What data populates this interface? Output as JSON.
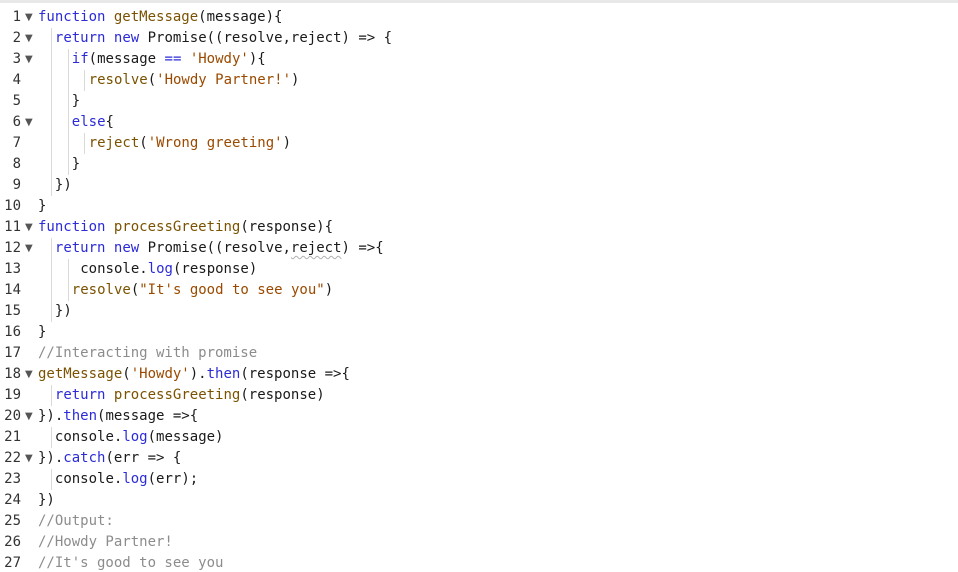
{
  "editor": {
    "lines": [
      {
        "n": "1",
        "fold": true,
        "indent": 0,
        "tokens": [
          [
            "kw",
            "function"
          ],
          [
            "pl",
            " "
          ],
          [
            "fn",
            "getMessage"
          ],
          [
            "pl",
            "(message){"
          ]
        ]
      },
      {
        "n": "2",
        "fold": true,
        "indent": 1,
        "tokens": [
          [
            "kw",
            "return"
          ],
          [
            "pl",
            " "
          ],
          [
            "kw",
            "new"
          ],
          [
            "pl",
            " Promise((resolve,reject) => {"
          ]
        ]
      },
      {
        "n": "3",
        "fold": true,
        "indent": 2,
        "tokens": [
          [
            "kw",
            "if"
          ],
          [
            "pl",
            "(message "
          ],
          [
            "kw",
            "=="
          ],
          [
            "pl",
            " "
          ],
          [
            "str",
            "'Howdy'"
          ],
          [
            "pl",
            "){"
          ]
        ]
      },
      {
        "n": "4",
        "fold": false,
        "indent": 3,
        "tokens": [
          [
            "fn",
            "resolve"
          ],
          [
            "pl",
            "("
          ],
          [
            "str",
            "'Howdy Partner!'"
          ],
          [
            "pl",
            ")"
          ]
        ]
      },
      {
        "n": "5",
        "fold": false,
        "indent": 2,
        "tokens": [
          [
            "pl",
            "}"
          ]
        ]
      },
      {
        "n": "6",
        "fold": true,
        "indent": 2,
        "tokens": [
          [
            "kw",
            "else"
          ],
          [
            "pl",
            "{"
          ]
        ]
      },
      {
        "n": "7",
        "fold": false,
        "indent": 3,
        "tokens": [
          [
            "fn",
            "reject"
          ],
          [
            "pl",
            "("
          ],
          [
            "str",
            "'Wrong greeting'"
          ],
          [
            "pl",
            ")"
          ]
        ]
      },
      {
        "n": "8",
        "fold": false,
        "indent": 2,
        "tokens": [
          [
            "pl",
            "}"
          ]
        ]
      },
      {
        "n": "9",
        "fold": false,
        "indent": 1,
        "tokens": [
          [
            "pl",
            "})"
          ]
        ]
      },
      {
        "n": "10",
        "fold": false,
        "indent": 0,
        "tokens": [
          [
            "pl",
            "}"
          ]
        ]
      },
      {
        "n": "11",
        "fold": true,
        "indent": 0,
        "tokens": [
          [
            "kw",
            "function"
          ],
          [
            "pl",
            " "
          ],
          [
            "fn",
            "processGreeting"
          ],
          [
            "pl",
            "(response){"
          ]
        ]
      },
      {
        "n": "12",
        "fold": true,
        "indent": 1,
        "tokens": [
          [
            "kw",
            "return"
          ],
          [
            "pl",
            " "
          ],
          [
            "kw",
            "new"
          ],
          [
            "pl",
            " Promise((resolve,"
          ],
          [
            "sq",
            "reject"
          ],
          [
            "pl",
            ") =>{"
          ]
        ]
      },
      {
        "n": "13",
        "fold": false,
        "indent": 2.5,
        "tokens": [
          [
            "pl",
            "console."
          ],
          [
            "mt",
            "log"
          ],
          [
            "pl",
            "(response)"
          ]
        ]
      },
      {
        "n": "14",
        "fold": false,
        "indent": 2,
        "tokens": [
          [
            "fn",
            "resolve"
          ],
          [
            "pl",
            "("
          ],
          [
            "str",
            "\"It's good to see you\""
          ],
          [
            "pl",
            ")"
          ]
        ]
      },
      {
        "n": "15",
        "fold": false,
        "indent": 1,
        "tokens": [
          [
            "pl",
            "})"
          ]
        ]
      },
      {
        "n": "16",
        "fold": false,
        "indent": 0,
        "tokens": [
          [
            "pl",
            "}"
          ]
        ]
      },
      {
        "n": "17",
        "fold": false,
        "indent": 0,
        "tokens": [
          [
            "cm",
            "//Interacting with promise"
          ]
        ]
      },
      {
        "n": "18",
        "fold": true,
        "indent": 0,
        "tokens": [
          [
            "fn",
            "getMessage"
          ],
          [
            "pl",
            "("
          ],
          [
            "str",
            "'Howdy'"
          ],
          [
            "pl",
            ")."
          ],
          [
            "mt",
            "then"
          ],
          [
            "pl",
            "(response =>{"
          ]
        ]
      },
      {
        "n": "19",
        "fold": false,
        "indent": 1,
        "tokens": [
          [
            "kw",
            "return"
          ],
          [
            "pl",
            " "
          ],
          [
            "fn",
            "processGreeting"
          ],
          [
            "pl",
            "(response)"
          ]
        ]
      },
      {
        "n": "20",
        "fold": true,
        "indent": 0,
        "tokens": [
          [
            "pl",
            "})."
          ],
          [
            "mt",
            "then"
          ],
          [
            "pl",
            "(message =>{"
          ]
        ]
      },
      {
        "n": "21",
        "fold": false,
        "indent": 1,
        "tokens": [
          [
            "pl",
            "console."
          ],
          [
            "mt",
            "log"
          ],
          [
            "pl",
            "(message)"
          ]
        ]
      },
      {
        "n": "22",
        "fold": true,
        "indent": 0,
        "tokens": [
          [
            "pl",
            "})."
          ],
          [
            "mt",
            "catch"
          ],
          [
            "pl",
            "(err => {"
          ]
        ]
      },
      {
        "n": "23",
        "fold": false,
        "indent": 1,
        "tokens": [
          [
            "pl",
            "console."
          ],
          [
            "mt",
            "log"
          ],
          [
            "pl",
            "(err);"
          ]
        ]
      },
      {
        "n": "24",
        "fold": false,
        "indent": 0,
        "tokens": [
          [
            "pl",
            "})"
          ]
        ]
      },
      {
        "n": "25",
        "fold": false,
        "indent": 0,
        "tokens": [
          [
            "cm",
            "//Output:"
          ]
        ]
      },
      {
        "n": "26",
        "fold": false,
        "indent": 0,
        "tokens": [
          [
            "cm",
            "//Howdy Partner!"
          ]
        ]
      },
      {
        "n": "27",
        "fold": false,
        "indent": 0,
        "tokens": [
          [
            "cm",
            "//It's good to see you"
          ]
        ]
      }
    ],
    "fold_glyph": "▼",
    "colors": {
      "keyword": "#2b2bd9",
      "function": "#7a5200",
      "string": "#9a4a00",
      "comment": "#8c8c8c"
    }
  }
}
